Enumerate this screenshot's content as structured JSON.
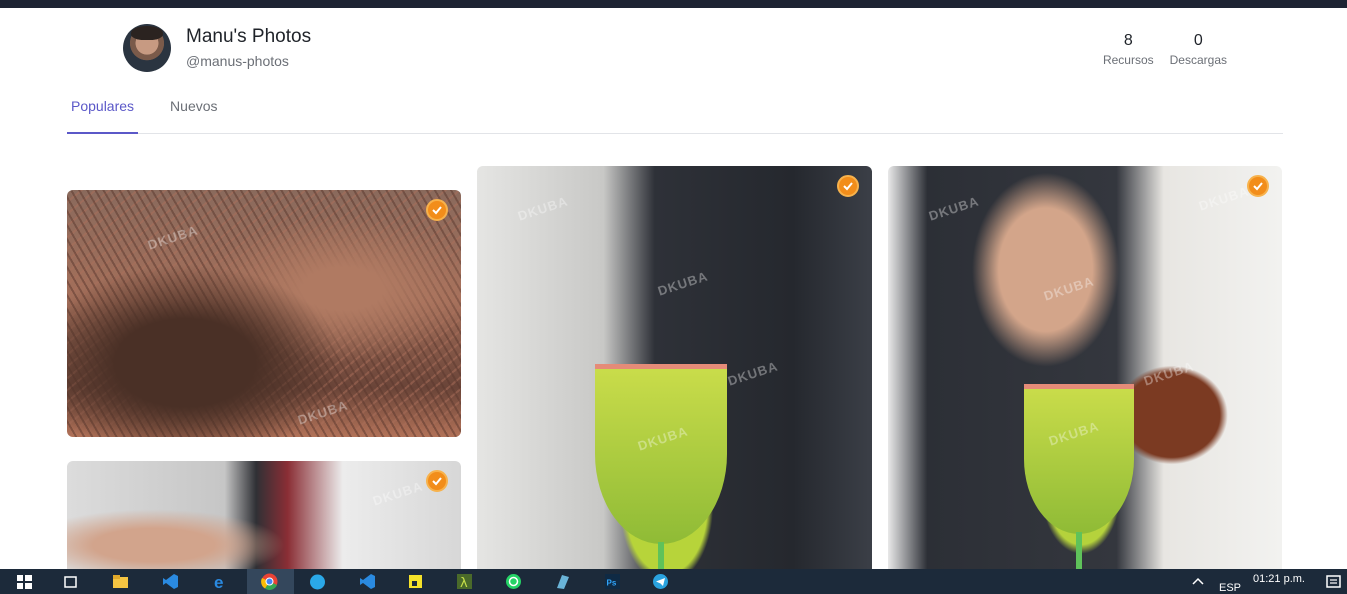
{
  "profile": {
    "name": "Manu's Photos",
    "handle": "@manus-photos"
  },
  "stats": [
    {
      "value": "8",
      "label": "Recursos"
    },
    {
      "value": "0",
      "label": "Descargas"
    }
  ],
  "tabs": [
    {
      "label": "Populares",
      "active": true
    },
    {
      "label": "Nuevos",
      "active": false
    }
  ],
  "photos": [
    {
      "subject": "dried plants close-up",
      "watermark": "DKUBA",
      "verified": true
    },
    {
      "subject": "bartender stirring cocktail",
      "watermark": "DKUBA",
      "verified": true
    },
    {
      "subject": "green cocktail with salted rim",
      "watermark": "DKUBA",
      "verified": true
    },
    {
      "subject": "bartender pouring from jigger",
      "watermark": "DKUBA",
      "verified": true
    }
  ],
  "taskbar": {
    "language": "ESP",
    "time": "01:21 p.m.",
    "icons": [
      "windows-start-icon",
      "task-view-icon",
      "file-explorer-icon",
      "vscode-icon",
      "edge-icon",
      "chrome-icon",
      "app-icon",
      "vscode-icon",
      "sticky-notes-icon",
      "lambda-app-icon",
      "whatsapp-icon",
      "app-icon",
      "photoshop-icon",
      "telegram-icon"
    ]
  },
  "colors": {
    "accent": "#5b58c8",
    "badge": "#f28d1a",
    "topbar": "#1e2433"
  }
}
